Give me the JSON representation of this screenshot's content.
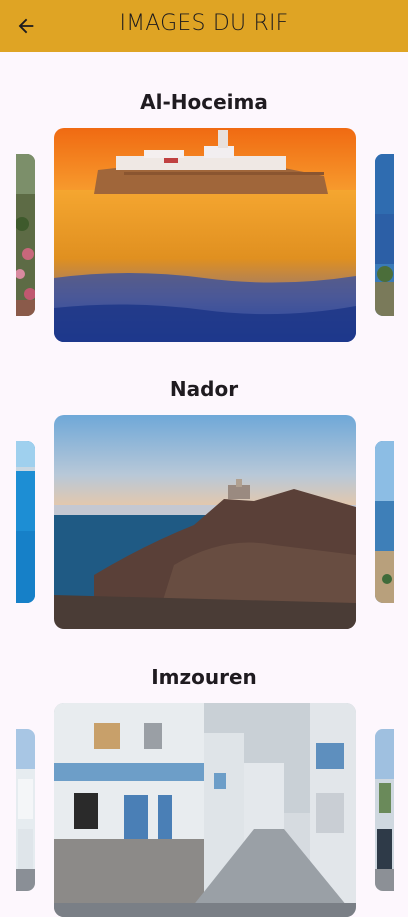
{
  "appbar": {
    "title": "IMAGES DU RIF",
    "back_icon": "arrow-left-icon",
    "background": "#dfa424"
  },
  "sections": [
    {
      "title": "Al-Hoceima",
      "image": "island-fortress-sunset-photo"
    },
    {
      "title": "Nador",
      "image": "coastal-cliff-lighthouse-photo"
    },
    {
      "title": "Imzouren",
      "image": "town-street-buildings-photo"
    }
  ]
}
